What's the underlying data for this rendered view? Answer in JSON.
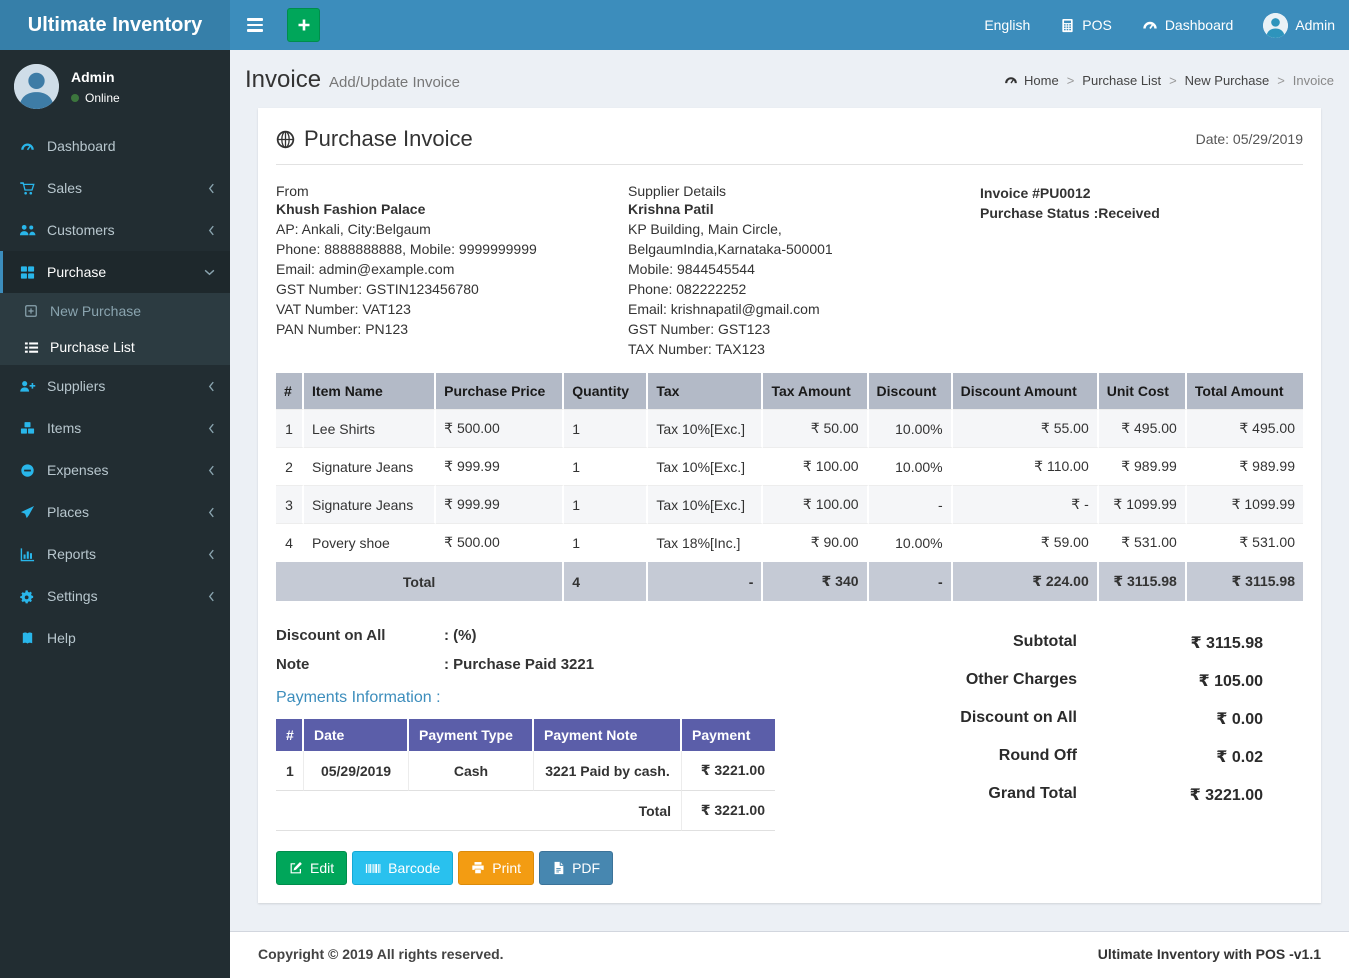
{
  "colors": {
    "navbar": "#3c8dbc",
    "brand": "#367fa9",
    "sidebar": "#222d32",
    "sidebar_submenu": "#2c3b41",
    "sidebar_icon": "#29b6ea",
    "active_border": "#3c8dbc",
    "content_bg": "#ecf0f5",
    "items_header_bg": "#b3bac7",
    "items_total_bg": "#c5cad5",
    "payments_header_bg": "#5b5ea9",
    "btn_edit": "#00a65a",
    "btn_barcode": "#29c1ee",
    "btn_print": "#f39c12",
    "btn_pdf": "#4787b0",
    "online_dot": "#3c763d"
  },
  "brand": {
    "title": "Ultimate Inventory"
  },
  "topnav": {
    "language": "English",
    "pos": "POS",
    "dashboard": "Dashboard",
    "user": "Admin"
  },
  "sidebar": {
    "user": {
      "name": "Admin",
      "status": "Online"
    },
    "items": [
      {
        "label": "Dashboard"
      },
      {
        "label": "Sales"
      },
      {
        "label": "Customers"
      },
      {
        "label": "Purchase"
      },
      {
        "label": "Suppliers"
      },
      {
        "label": "Items"
      },
      {
        "label": "Expenses"
      },
      {
        "label": "Places"
      },
      {
        "label": "Reports"
      },
      {
        "label": "Settings"
      },
      {
        "label": "Help"
      }
    ],
    "purchase_submenu": [
      {
        "label": "New Purchase"
      },
      {
        "label": "Purchase List"
      }
    ]
  },
  "page": {
    "title": "Invoice",
    "subtitle": "Add/Update Invoice",
    "breadcrumb": [
      "Home",
      "Purchase List",
      "New Purchase",
      "Invoice"
    ],
    "breadcrumb_separator": ">"
  },
  "invoice": {
    "heading": "Purchase Invoice",
    "date": "Date: 05/29/2019",
    "from": {
      "label": "From",
      "name": "Khush Fashion Palace",
      "lines": [
        "AP: Ankali, City:Belgaum",
        "Phone: 8888888888, Mobile: 9999999999",
        "Email: admin@example.com",
        "GST Number: GSTIN123456780",
        "VAT Number: VAT123",
        "PAN Number: PN123"
      ]
    },
    "supplier": {
      "label": "Supplier Details",
      "name": "Krishna Patil",
      "address": "KP Building, Main Circle, BelgaumIndia,Karnataka-500001",
      "lines": [
        "Mobile: 9844545544",
        "Phone: 082222252",
        "Email: krishnapatil@gmail.com",
        "GST Number: GST123",
        "TAX Number: TAX123"
      ]
    },
    "meta": {
      "number": "Invoice #PU0012",
      "status": "Purchase Status :Received"
    },
    "items_table": {
      "headers": [
        "#",
        "Item Name",
        "Purchase Price",
        "Quantity",
        "Tax",
        "Tax Amount",
        "Discount",
        "Discount Amount",
        "Unit Cost",
        "Total Amount"
      ],
      "rows": [
        {
          "sn": "1",
          "name": "Lee Shirts",
          "purchase_price": "₹ 500.00",
          "qty": "1",
          "tax": "Tax 10%[Exc.]",
          "tax_amount": "₹ 50.00",
          "discount": "10.00%",
          "discount_amount": "₹ 55.00",
          "unit_cost": "₹ 495.00",
          "total_amount": "₹ 495.00"
        },
        {
          "sn": "2",
          "name": "Signature Jeans",
          "purchase_price": "₹ 999.99",
          "qty": "1",
          "tax": "Tax 10%[Exc.]",
          "tax_amount": "₹ 100.00",
          "discount": "10.00%",
          "discount_amount": "₹ 110.00",
          "unit_cost": "₹ 989.99",
          "total_amount": "₹ 989.99"
        },
        {
          "sn": "3",
          "name": "Signature Jeans",
          "purchase_price": "₹ 999.99",
          "qty": "1",
          "tax": "Tax 10%[Exc.]",
          "tax_amount": "₹ 100.00",
          "discount": "-",
          "discount_amount": "₹ -",
          "unit_cost": "₹ 1099.99",
          "total_amount": "₹ 1099.99"
        },
        {
          "sn": "4",
          "name": "Povery shoe",
          "purchase_price": "₹ 500.00",
          "qty": "1",
          "tax": "Tax 18%[Inc.]",
          "tax_amount": "₹ 90.00",
          "discount": "10.00%",
          "discount_amount": "₹ 59.00",
          "unit_cost": "₹ 531.00",
          "total_amount": "₹ 531.00"
        }
      ],
      "total": {
        "label": "Total",
        "qty": "4",
        "tax": "-",
        "tax_amount": "₹ 340",
        "discount": "-",
        "discount_amount": "₹ 224.00",
        "unit_cost": "₹ 3115.98",
        "total_amount": "₹ 3115.98"
      }
    },
    "discount_on_all": {
      "label": "Discount on All",
      "value": ": (%)"
    },
    "note": {
      "label": "Note",
      "value": ": Purchase Paid 3221"
    },
    "payments": {
      "heading": "Payments Information :",
      "headers": [
        "#",
        "Date",
        "Payment Type",
        "Payment Note",
        "Payment"
      ],
      "rows": [
        {
          "sn": "1",
          "date": "05/29/2019",
          "type": "Cash",
          "note": "3221 Paid by cash.",
          "amount": "₹ 3221.00"
        }
      ],
      "total_label": "Total",
      "total_amount": "₹ 3221.00"
    },
    "summary": [
      {
        "label": "Subtotal",
        "value": "₹ 3115.98"
      },
      {
        "label": "Other Charges",
        "value": "₹ 105.00"
      },
      {
        "label": "Discount on All",
        "value": "₹ 0.00"
      },
      {
        "label": "Round Off",
        "value": "₹ 0.02"
      },
      {
        "label": "Grand Total",
        "value": "₹ 3221.00"
      }
    ],
    "actions": [
      {
        "label": "Edit"
      },
      {
        "label": "Barcode"
      },
      {
        "label": "Print"
      },
      {
        "label": "PDF"
      }
    ]
  },
  "footer": {
    "left": "Copyright © 2019 All rights reserved.",
    "right": "Ultimate Inventory with POS -v1.1"
  }
}
